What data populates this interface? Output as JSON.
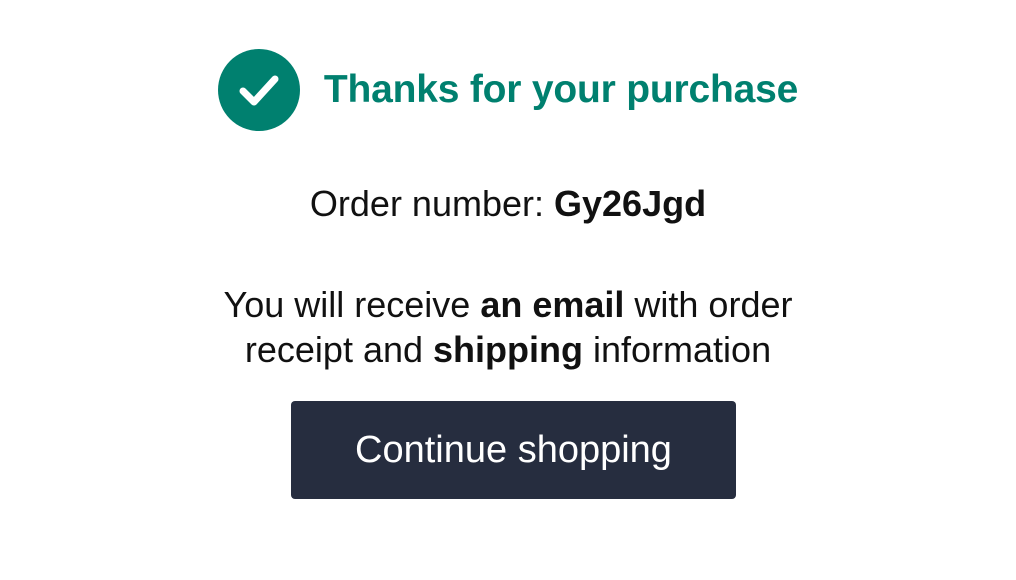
{
  "confirmation": {
    "title": "Thanks for your purchase",
    "icon": "check-circle-icon",
    "accent_color": "#00806f"
  },
  "order": {
    "label": "Order number: ",
    "number": "Gy26Jgd"
  },
  "message": {
    "line1_part1": "You will receive ",
    "line1_bold": "an email",
    "line1_part2": " with order",
    "line2_part1": "receipt and ",
    "line2_bold": "shipping",
    "line2_part2": " information"
  },
  "actions": {
    "continue_label": "Continue shopping",
    "button_color": "#262d3f"
  }
}
